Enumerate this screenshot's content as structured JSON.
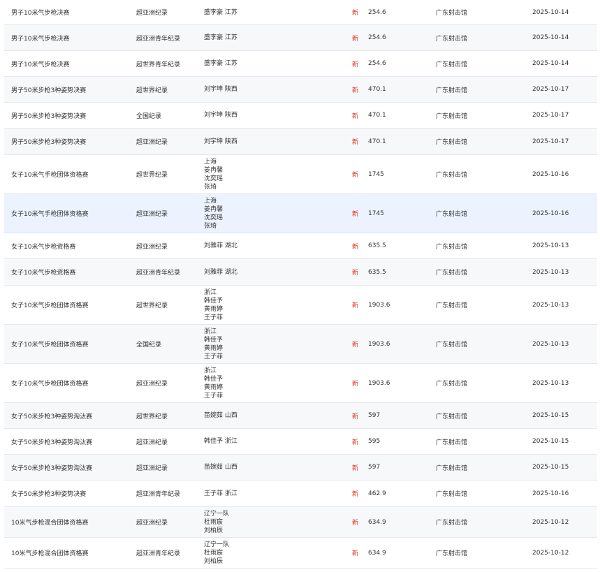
{
  "records": [
    {
      "event": "男子10米气步枪决赛",
      "record": "超亚洲纪录",
      "holder": [
        "盛李豪 江苏"
      ],
      "mark": "新",
      "score": "254.6",
      "venue": "广东射击馆",
      "date": "2025-10-14"
    },
    {
      "event": "男子10米气步枪决赛",
      "record": "超亚洲青年纪录",
      "holder": [
        "盛李豪 江苏"
      ],
      "mark": "新",
      "score": "254.6",
      "venue": "广东射击馆",
      "date": "2025-10-14"
    },
    {
      "event": "男子10米气步枪决赛",
      "record": "超世界青年纪录",
      "holder": [
        "盛李豪 江苏"
      ],
      "mark": "新",
      "score": "254.6",
      "venue": "广东射击馆",
      "date": "2025-10-14"
    },
    {
      "event": "男子50米步枪3种姿势决赛",
      "record": "超世界纪录",
      "holder": [
        "刘宇坤 陕西"
      ],
      "mark": "新",
      "score": "470.1",
      "venue": "广东射击馆",
      "date": "2025-10-17"
    },
    {
      "event": "男子50米步枪3种姿势决赛",
      "record": "全国纪录",
      "holder": [
        "刘宇坤 陕西"
      ],
      "mark": "新",
      "score": "470.1",
      "venue": "广东射击馆",
      "date": "2025-10-17"
    },
    {
      "event": "男子50米步枪3种姿势决赛",
      "record": "超亚洲纪录",
      "holder": [
        "刘宇坤 陕西"
      ],
      "mark": "新",
      "score": "470.1",
      "venue": "广东射击馆",
      "date": "2025-10-17"
    },
    {
      "event": "女子10米气手枪团体资格赛",
      "record": "超世界纪录",
      "holder": [
        "上海",
        "姜冉馨",
        "沈奕瑶",
        "张琦"
      ],
      "mark": "新",
      "score": "1745",
      "venue": "广东射击馆",
      "date": "2025-10-16"
    },
    {
      "event": "女子10米气手枪团体资格赛",
      "record": "超亚洲纪录",
      "holder": [
        "上海",
        "姜冉馨",
        "沈奕瑶",
        "张琦"
      ],
      "mark": "新",
      "score": "1745",
      "venue": "广东射击馆",
      "date": "2025-10-16"
    },
    {
      "event": "女子10米气步枪资格赛",
      "record": "超亚洲纪录",
      "holder": [
        "刘雅菲 湖北"
      ],
      "mark": "新",
      "score": "635.5",
      "venue": "广东射击馆",
      "date": "2025-10-13"
    },
    {
      "event": "女子10米气步枪资格赛",
      "record": "超亚洲青年纪录",
      "holder": [
        "刘雅菲 湖北"
      ],
      "mark": "新",
      "score": "635.5",
      "venue": "广东射击馆",
      "date": "2025-10-13"
    },
    {
      "event": "女子10米气步枪团体资格赛",
      "record": "超世界纪录",
      "holder": [
        "浙江",
        "韩佳予",
        "黄雨婷",
        "王子菲"
      ],
      "mark": "新",
      "score": "1903.6",
      "venue": "广东射击馆",
      "date": "2025-10-13"
    },
    {
      "event": "女子10米气步枪团体资格赛",
      "record": "全国纪录",
      "holder": [
        "浙江",
        "韩佳予",
        "黄雨婷",
        "王子菲"
      ],
      "mark": "新",
      "score": "1903.6",
      "venue": "广东射击馆",
      "date": "2025-10-13"
    },
    {
      "event": "女子10米气步枪团体资格赛",
      "record": "超亚洲纪录",
      "holder": [
        "浙江",
        "韩佳予",
        "黄雨婷",
        "王子菲"
      ],
      "mark": "新",
      "score": "1903.6",
      "venue": "广东射击馆",
      "date": "2025-10-13"
    },
    {
      "event": "女子50米步枪3种姿势淘汰赛",
      "record": "超世界纪录",
      "holder": [
        "苗婉茹 山西"
      ],
      "mark": "新",
      "score": "597",
      "venue": "广东射击馆",
      "date": "2025-10-15"
    },
    {
      "event": "女子50米步枪3种姿势淘汰赛",
      "record": "超亚洲纪录",
      "holder": [
        "韩佳予 浙江"
      ],
      "mark": "新",
      "score": "595",
      "venue": "广东射击馆",
      "date": "2025-10-15"
    },
    {
      "event": "女子50米步枪3种姿势淘汰赛",
      "record": "超亚洲纪录",
      "holder": [
        "苗婉茹 山西"
      ],
      "mark": "新",
      "score": "597",
      "venue": "广东射击馆",
      "date": "2025-10-15"
    },
    {
      "event": "女子50米步枪3种姿势决赛",
      "record": "超亚洲青年纪录",
      "holder": [
        "王子菲 浙江"
      ],
      "mark": "新",
      "score": "462.9",
      "venue": "广东射击馆",
      "date": "2025-10-16"
    },
    {
      "event": "10米气步枪混合团体资格赛",
      "record": "超亚洲纪录",
      "holder": [
        "辽宁一队",
        "杜雨宸",
        "刘柏辰"
      ],
      "mark": "新",
      "score": "634.9",
      "venue": "广东射击馆",
      "date": "2025-10-12"
    },
    {
      "event": "10米气步枪混合团体资格赛",
      "record": "超亚洲青年纪录",
      "holder": [
        "辽宁一队",
        "杜雨宸",
        "刘柏辰"
      ],
      "mark": "新",
      "score": "634.9",
      "venue": "广东射击馆",
      "date": "2025-10-12"
    }
  ]
}
